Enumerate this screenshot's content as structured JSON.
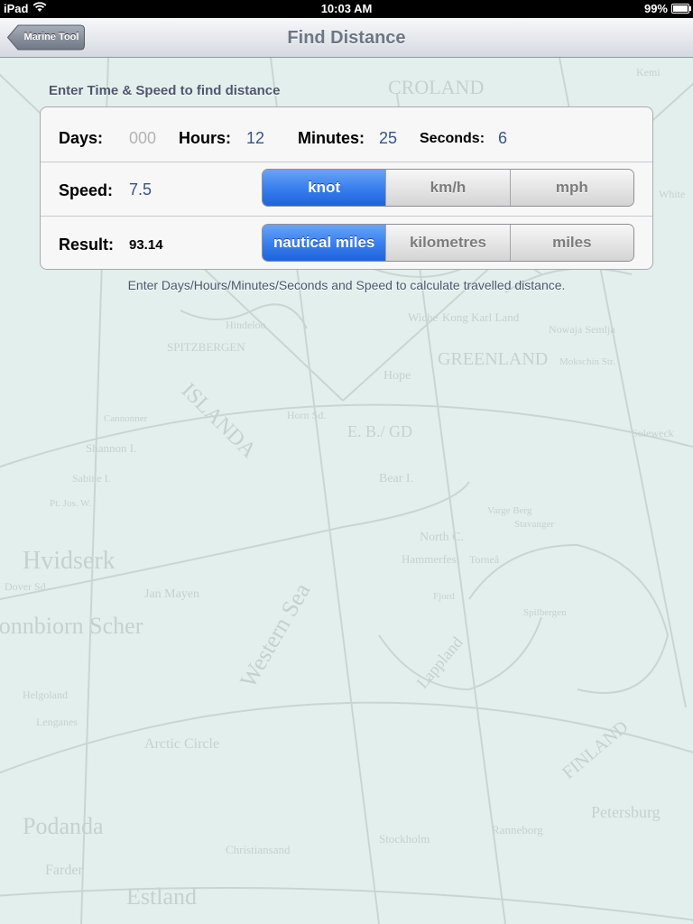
{
  "status": {
    "device": "iPad",
    "time": "10:03 AM",
    "battery": "99%",
    "battery_level": 0.99
  },
  "nav": {
    "title": "Find Distance",
    "back_label": "Marine Tool"
  },
  "form": {
    "header": "Enter Time & Speed to find distance",
    "days_label": "Days:",
    "days_value": "000",
    "hours_label": "Hours:",
    "hours_value": "12",
    "minutes_label": "Minutes:",
    "minutes_value": "25",
    "seconds_label": "Seconds:",
    "seconds_value": "6",
    "speed_label": "Speed:",
    "speed_value": "7.5",
    "speed_units": [
      "knot",
      "km/h",
      "mph"
    ],
    "speed_selected": "knot",
    "result_label": "Result:",
    "result_value": "93.14",
    "distance_units": [
      "nautical miles",
      "kilometres",
      "miles"
    ],
    "distance_selected": "nautical miles",
    "note": "Enter Days/Hours/Minutes/Seconds and Speed to calculate travelled distance."
  },
  "map_labels": [
    "CROLAND",
    "GREENLAND",
    "ISLANDA",
    "Hvidserk",
    "Jan Mayen",
    "Western Sea",
    "Arctic Circle",
    "Podanda",
    "Estland",
    "Petersburg",
    "FINLAND",
    "SPITZBERGEN",
    "Nowaja Semlja",
    "Wiche",
    "Kong Karl Land",
    "Hope",
    "Bear I.",
    "North C.",
    "Hammerfest",
    "Lappland",
    "Torneå",
    "Christiansand",
    "Stockholm",
    "Ranneborg",
    "Farder",
    "Helgoland",
    "E. B./ GD",
    "Shannon I.",
    "Sabine I.",
    "Lenganes",
    "Gonnbiorn Scher",
    "Dover Sd.",
    "Horn Sd.",
    "Hindeloo",
    "White",
    "Kemi",
    "Pt. Jos. W.",
    "Cannonner",
    "Mokschin Str.",
    "Soleweck",
    "Varge Berg",
    "Stavanger",
    "Fjord",
    "Spilbergen"
  ],
  "colors": {
    "accent": "#3a80ef",
    "value_blue": "#385487",
    "background": "#e3efec"
  }
}
